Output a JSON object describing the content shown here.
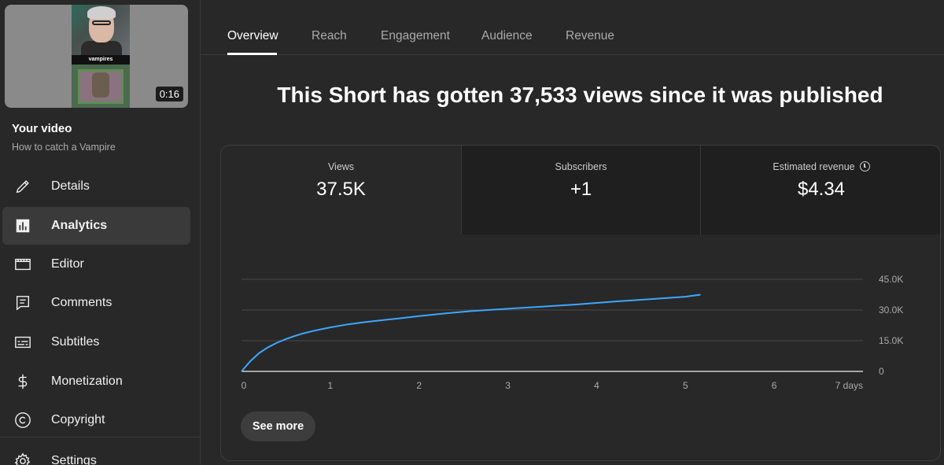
{
  "sidebar": {
    "thumbnail": {
      "caption": "vampires",
      "duration": "0:16"
    },
    "your_video_label": "Your video",
    "video_title": "How to catch a Vampire",
    "items": [
      {
        "label": "Details",
        "icon": "pencil-icon",
        "active": false
      },
      {
        "label": "Analytics",
        "icon": "analytics-icon",
        "active": true
      },
      {
        "label": "Editor",
        "icon": "clapperboard-icon",
        "active": false
      },
      {
        "label": "Comments",
        "icon": "comments-icon",
        "active": false
      },
      {
        "label": "Subtitles",
        "icon": "subtitles-icon",
        "active": false
      },
      {
        "label": "Monetization",
        "icon": "dollar-icon",
        "active": false
      },
      {
        "label": "Copyright",
        "icon": "copyright-icon",
        "active": false
      },
      {
        "label": "Settings",
        "icon": "gear-icon",
        "active": false
      }
    ]
  },
  "tabs": [
    {
      "label": "Overview",
      "active": true
    },
    {
      "label": "Reach",
      "active": false
    },
    {
      "label": "Engagement",
      "active": false
    },
    {
      "label": "Audience",
      "active": false
    },
    {
      "label": "Revenue",
      "active": false
    }
  ],
  "headline": "This Short has gotten 37,533 views since it was published",
  "metrics": [
    {
      "label": "Views",
      "value": "37.5K"
    },
    {
      "label": "Subscribers",
      "value": "+1"
    },
    {
      "label": "Estimated revenue",
      "value": "$4.34",
      "icon": "clock-icon"
    }
  ],
  "see_more_label": "See more",
  "colors": {
    "line": "#3ea6ff",
    "background": "#282828",
    "card_dark": "#1f1f1f"
  },
  "chart_data": {
    "type": "line",
    "x_tick_labels": [
      "0",
      "1",
      "2",
      "3",
      "4",
      "5",
      "6",
      "7 days"
    ],
    "y_tick_labels": [
      "0",
      "15.0K",
      "30.0K",
      "45.0K"
    ],
    "xlim": [
      0,
      7
    ],
    "ylim": [
      0,
      45000
    ],
    "grid": true,
    "series": [
      {
        "x": [
          0,
          0.05,
          0.1,
          0.2,
          0.3,
          0.4,
          0.5,
          0.6,
          0.7,
          0.8,
          0.9,
          1.0,
          1.2,
          1.4,
          1.6,
          1.8,
          2.0,
          2.3,
          2.6,
          3.0,
          3.4,
          3.8,
          4.2,
          4.6,
          5.0,
          5.17
        ],
        "y": [
          0,
          2500,
          5000,
          9000,
          11800,
          14000,
          15800,
          17300,
          18600,
          19700,
          20600,
          21500,
          23000,
          24100,
          25100,
          26000,
          27000,
          28400,
          29500,
          30600,
          31700,
          32800,
          34100,
          35300,
          36500,
          37500
        ]
      }
    ]
  }
}
